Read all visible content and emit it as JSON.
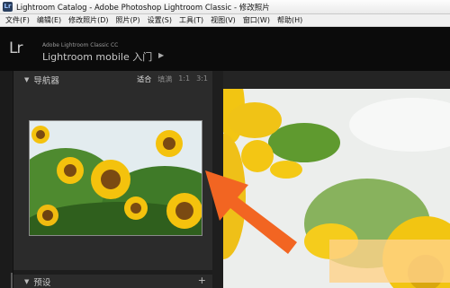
{
  "window": {
    "title": "Lightroom Catalog - Adobe Photoshop Lightroom Classic - 修改照片",
    "icon_letters": "Lr"
  },
  "menu": [
    "文件(F)",
    "编辑(E)",
    "修改照片(D)",
    "照片(P)",
    "设置(S)",
    "工具(T)",
    "视图(V)",
    "窗口(W)",
    "帮助(H)"
  ],
  "identity": {
    "logo": "Lr",
    "product": "Adobe Lightroom Classic CC",
    "mobile_label": "Lightroom mobile 入门",
    "arrow": "▶"
  },
  "navigator": {
    "triangle": "▼",
    "title": "导航器",
    "zoom_options": [
      "适合",
      "填满",
      "1:1",
      "3:1"
    ],
    "active_zoom": "适合"
  },
  "presets": {
    "triangle": "▼",
    "title": "预设",
    "add": "+"
  },
  "colors": {
    "accent_arrow": "#f26522",
    "panel_bg": "#2b2b2b",
    "sunflower_yellow": "#f2c512"
  },
  "icons": [
    "lightroom-app-icon",
    "panel-collapse-triangle-icon",
    "add-preset-icon",
    "orange-pointer-arrow"
  ]
}
